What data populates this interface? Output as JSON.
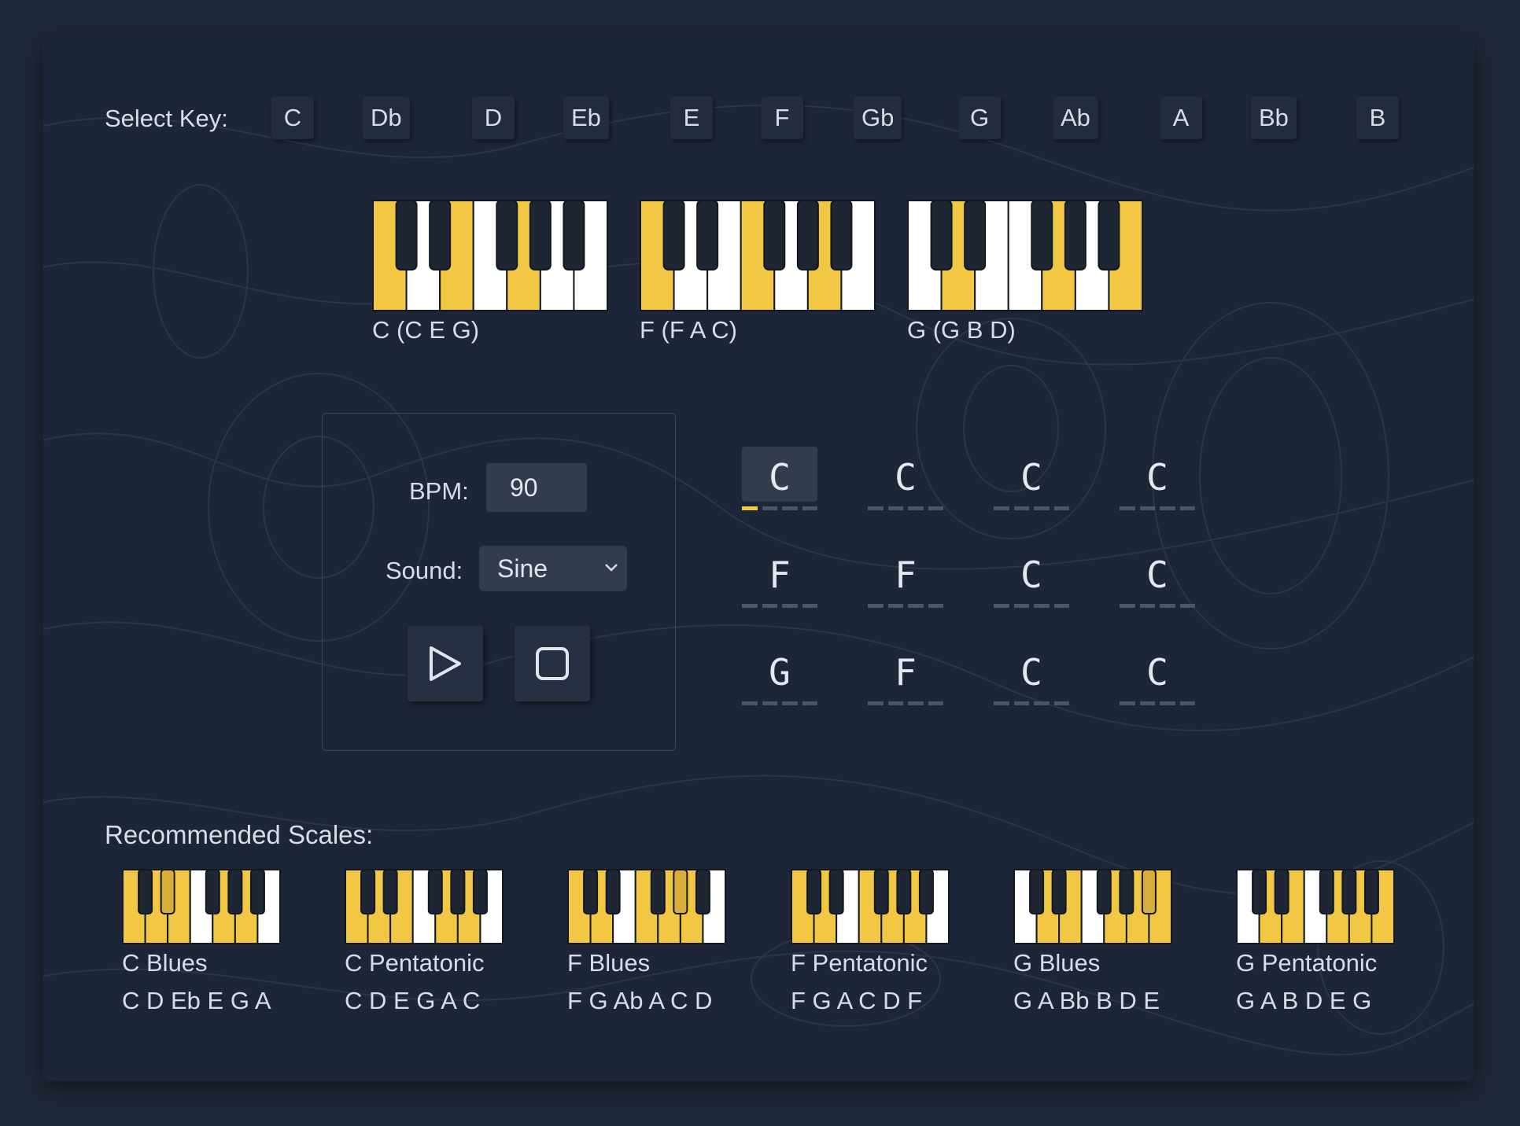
{
  "colors": {
    "highlight": "#f2c744",
    "accent_beat": "#f2c744",
    "background": "#1f2837",
    "panel": "#1d2636"
  },
  "select_key": {
    "label": "Select Key:",
    "keys": [
      "C",
      "Db",
      "D",
      "Eb",
      "E",
      "F",
      "Gb",
      "G",
      "Ab",
      "A",
      "Bb",
      "B"
    ]
  },
  "chords": [
    {
      "label": "C (C E G)",
      "highlighted_white_keys": [
        "C",
        "E",
        "G"
      ],
      "highlighted_black_keys": []
    },
    {
      "label": "F (F A C)",
      "highlighted_white_keys": [
        "C",
        "F",
        "A"
      ],
      "highlighted_black_keys": []
    },
    {
      "label": "G (G B D)",
      "highlighted_white_keys": [
        "D",
        "G",
        "B"
      ],
      "highlighted_black_keys": []
    }
  ],
  "controls": {
    "bpm_label": "BPM:",
    "bpm_value": "90",
    "sound_label": "Sound:",
    "sound_value": "Sine",
    "play_icon": "play-icon",
    "stop_icon": "stop-icon"
  },
  "progression": {
    "rows": [
      [
        "C",
        "C",
        "C",
        "C"
      ],
      [
        "F",
        "F",
        "C",
        "C"
      ],
      [
        "G",
        "F",
        "C",
        "C"
      ]
    ],
    "active_cell": [
      0,
      0
    ],
    "active_beat": 0
  },
  "recommended": {
    "label": "Recommended Scales:",
    "scales": [
      {
        "name": "C Blues",
        "notes": "C D Eb E G A",
        "white": [
          "C",
          "D",
          "E",
          "G",
          "A"
        ],
        "black": [
          "Eb"
        ]
      },
      {
        "name": "C Pentatonic",
        "notes": "C D E G A C",
        "white": [
          "C",
          "D",
          "E",
          "G",
          "A"
        ],
        "black": []
      },
      {
        "name": "F Blues",
        "notes": "F G Ab A C D",
        "white": [
          "C",
          "D",
          "F",
          "G",
          "A"
        ],
        "black": [
          "Ab"
        ]
      },
      {
        "name": "F Pentatonic",
        "notes": "F G A C D F",
        "white": [
          "C",
          "D",
          "F",
          "G",
          "A"
        ],
        "black": []
      },
      {
        "name": "G Blues",
        "notes": "G A Bb B D E",
        "white": [
          "D",
          "E",
          "G",
          "A",
          "B"
        ],
        "black": [
          "Bb"
        ]
      },
      {
        "name": "G Pentatonic",
        "notes": "G A B D E G",
        "white": [
          "D",
          "E",
          "G",
          "A",
          "B"
        ],
        "black": []
      }
    ]
  }
}
